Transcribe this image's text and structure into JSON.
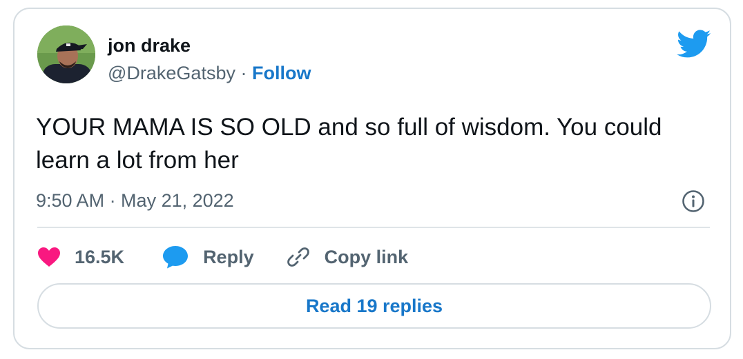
{
  "author": {
    "name": "jon drake",
    "handle": "@DrakeGatsby",
    "separator": "·",
    "follow_label": "Follow"
  },
  "tweet": {
    "text": "YOUR MAMA IS SO OLD and so full of wisdom. You could learn a lot from her",
    "timestamp": "9:50 AM · May 21, 2022"
  },
  "actions": {
    "like_count": "16.5K",
    "reply_label": "Reply",
    "copy_link_label": "Copy link"
  },
  "read_replies_label": "Read 19 replies",
  "colors": {
    "accent": "#1d9bf0",
    "link": "#1877c9",
    "heart": "#f91880",
    "muted": "#536471",
    "text": "#0f1419",
    "border": "#d6dde2"
  },
  "icons": [
    "twitter-bird-icon",
    "info-icon",
    "heart-icon",
    "reply-bubble-icon",
    "link-icon"
  ]
}
